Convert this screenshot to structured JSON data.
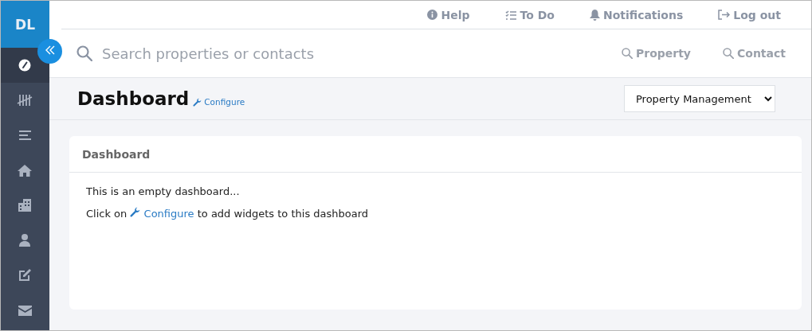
{
  "logo": "DL",
  "sidebar": {
    "items": [
      {
        "kind": "gauge",
        "selected": true
      },
      {
        "kind": "tally",
        "selected": false
      },
      {
        "kind": "bars",
        "selected": false
      },
      {
        "kind": "home",
        "selected": false
      },
      {
        "kind": "building",
        "selected": false
      },
      {
        "kind": "user",
        "selected": false
      },
      {
        "kind": "edit",
        "selected": false
      },
      {
        "kind": "mail",
        "selected": false
      }
    ]
  },
  "top_links": [
    {
      "kind": "help",
      "label": "Help"
    },
    {
      "kind": "todo",
      "label": "To Do"
    },
    {
      "kind": "bell",
      "label": "Notifications"
    },
    {
      "kind": "logout",
      "label": "Log out"
    }
  ],
  "search": {
    "placeholder": "Search properties or contacts",
    "buttons": [
      "Property",
      "Contact"
    ]
  },
  "header": {
    "title": "Dashboard",
    "configure": "Configure",
    "select": "Property Management"
  },
  "card": {
    "title": "Dashboard",
    "lines": [
      {
        "kind": "text",
        "text": "This is an empty dashboard..."
      },
      {
        "kind": "link",
        "before": "Click on",
        "link": "Configure",
        "after": "to add widgets to this dashboard"
      }
    ]
  }
}
